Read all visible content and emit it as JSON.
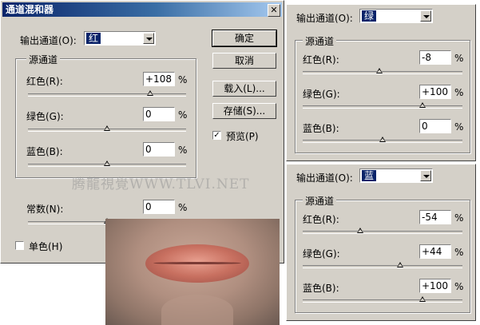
{
  "main": {
    "title": "通道混和器",
    "close_icon": "close-icon",
    "output_label": "输出通道(O):",
    "output_value": "红",
    "source_label": "源通道",
    "red_label": "红色(R):",
    "red_value": "+108",
    "red_level": 108,
    "green_label": "绿色(G):",
    "green_value": "0",
    "green_level": 0,
    "blue_label": "蓝色(B):",
    "blue_value": "0",
    "blue_level": 0,
    "const_label": "常数(N):",
    "const_value": "0",
    "percent": "%",
    "ok": "确定",
    "cancel": "取消",
    "load": "载入(L)...",
    "save": "存储(S)...",
    "preview": "预览(P)",
    "preview_checked": true,
    "mono": "单色(H)",
    "mono_checked": false
  },
  "green_panel": {
    "output_label": "输出通道(O):",
    "output_value": "绿",
    "source_label": "源通道",
    "red_label": "红色(R):",
    "red_value": "-8",
    "green_label": "绿色(G):",
    "green_value": "+100",
    "blue_label": "蓝色(B):",
    "blue_value": "0",
    "percent": "%"
  },
  "blue_panel": {
    "output_label": "输出通道(O):",
    "output_value": "蓝",
    "source_label": "源通道",
    "red_label": "红色(R):",
    "red_value": "-54",
    "green_label": "绿色(G):",
    "green_value": "+44",
    "blue_label": "蓝色(B):",
    "blue_value": "+100",
    "percent": "%"
  },
  "watermark": "腾龍視覺WWW.TLVI.NET"
}
